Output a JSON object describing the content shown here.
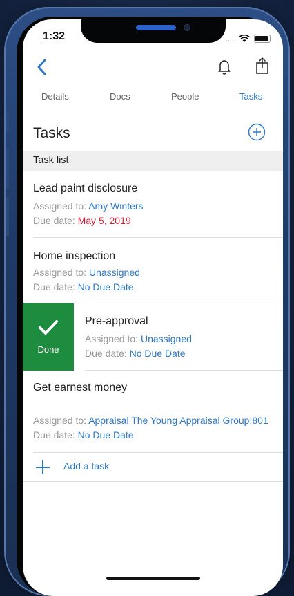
{
  "status": {
    "time": "1:32",
    "dots": "...."
  },
  "tabs": [
    {
      "label": "Details"
    },
    {
      "label": "Docs"
    },
    {
      "label": "People"
    },
    {
      "label": "Tasks"
    }
  ],
  "header": {
    "title": "Tasks"
  },
  "tasklist": {
    "label": "Task list"
  },
  "tasks": [
    {
      "name": "Lead paint disclosure",
      "assigned_label": "Assigned to:",
      "assigned": "Amy Winters",
      "due_label": "Due date:",
      "due": "May 5, 2019"
    },
    {
      "name": "Home inspection",
      "assigned_label": "Assigned to:",
      "assigned": "Unassigned",
      "due_label": "Due date:",
      "due": "No Due Date"
    },
    {
      "name": "Pre-approval",
      "assigned_label": "Assigned to:",
      "assigned": "Unassigned",
      "due_label": "Due date:",
      "due": "No Due Date"
    },
    {
      "name": "Get earnest money",
      "assigned_label": "Assigned to:",
      "assigned": "Appraisal The Young Appraisal Group:801",
      "due_label": "Due date:",
      "due": "No Due Date"
    }
  ],
  "swipe_action": {
    "label": "Done",
    "color": "#1e8c3e"
  },
  "add_task": {
    "label": "Add a task"
  },
  "colors": {
    "accent": "#2f78c4",
    "overdue": "#d0223a"
  }
}
